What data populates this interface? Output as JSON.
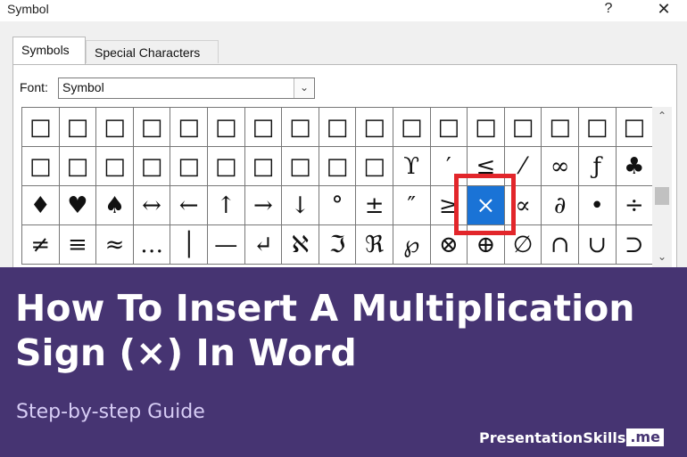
{
  "dialog": {
    "title": "Symbol",
    "help_label": "?",
    "close_label": "✕",
    "tabs": [
      {
        "label": "Symbols",
        "active": true
      },
      {
        "label": "Special Characters",
        "active": false
      }
    ],
    "font_label": "Font:",
    "font_value": "Symbol",
    "grid": {
      "rows": [
        [
          "□",
          "□",
          "□",
          "□",
          "□",
          "□",
          "□",
          "□",
          "□",
          "□",
          "□",
          "□",
          "□",
          "□",
          "□",
          "□",
          "□"
        ],
        [
          "□",
          "□",
          "□",
          "□",
          "□",
          "□",
          "□",
          "□",
          "□",
          "□",
          "ϒ",
          "′",
          "≤",
          "⁄",
          "∞",
          "ƒ",
          "♣"
        ],
        [
          "♦",
          "♥",
          "♠",
          "↔",
          "←",
          "↑",
          "→",
          "↓",
          "°",
          "±",
          "″",
          "≥",
          "×",
          "∝",
          "∂",
          "•",
          "÷"
        ],
        [
          "≠",
          "≡",
          "≈",
          "…",
          "│",
          "—",
          "↵",
          "ℵ",
          "ℑ",
          "ℜ",
          "℘",
          "⊗",
          "⊕",
          "∅",
          "∩",
          "∪",
          "⊃"
        ]
      ],
      "selected_symbol": "×"
    }
  },
  "banner": {
    "headline": "How To Insert A Multiplication Sign (×) In Word",
    "subtitle": "Step-by-step Guide",
    "brand_main": "PresentationSkills",
    "brand_tld": ".me"
  },
  "colors": {
    "banner_bg": "#463472",
    "selection_blue": "#1a73d6",
    "highlight_red": "#e2262b"
  }
}
